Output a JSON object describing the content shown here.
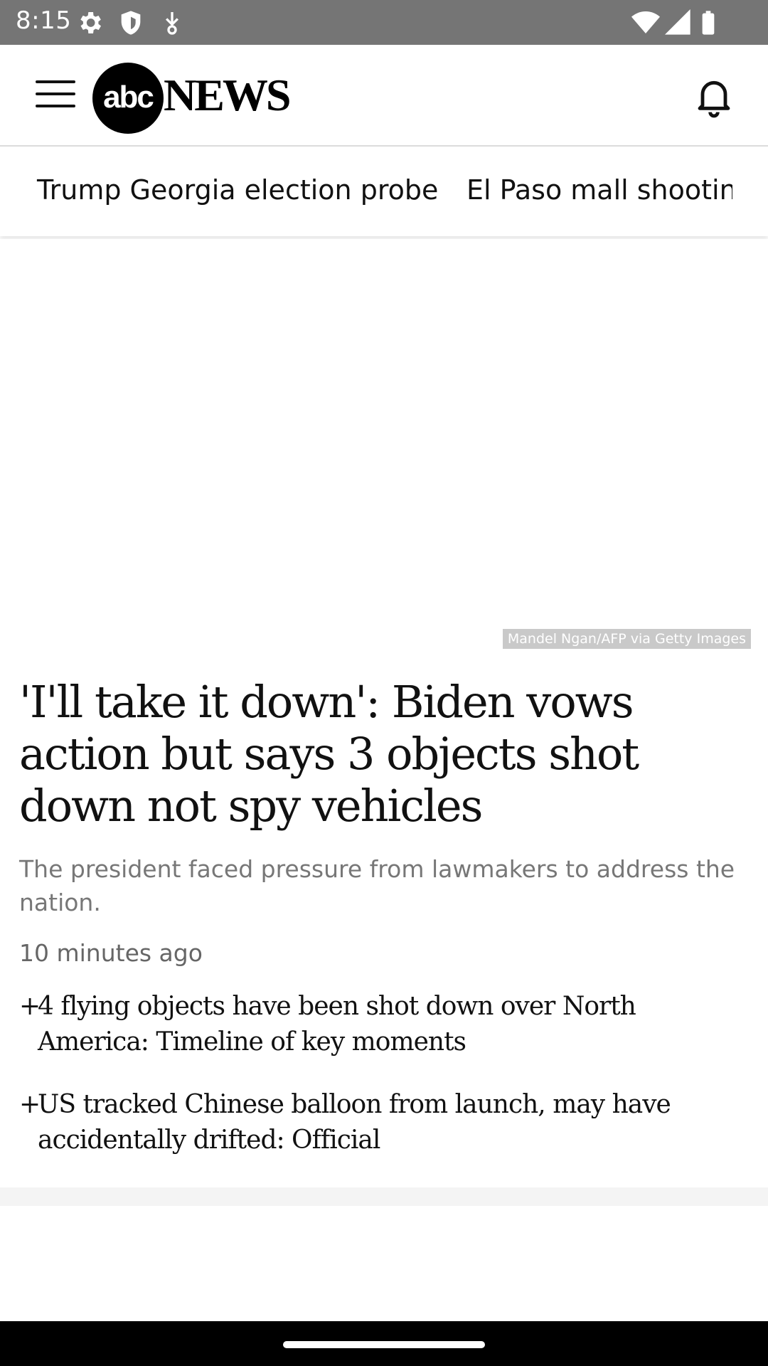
{
  "status_bar": {
    "time": "8:15",
    "icons_left": [
      "gear-icon",
      "shield-icon",
      "download-icon"
    ],
    "icons_right": [
      "wifi-icon",
      "signal-icon",
      "battery-icon"
    ]
  },
  "header": {
    "logo_mark": "abc",
    "logo_text": "NEWS"
  },
  "topics": [
    "Trump Georgia election probe",
    "El Paso mall shooting"
  ],
  "article": {
    "image_credit": "Mandel Ngan/AFP via Getty Images",
    "headline": "'I'll take it down': Biden vows action but says 3 objects shot down not spy vehicles",
    "summary": "The president faced pressure from lawmakers to address the nation.",
    "timestamp": "10 minutes ago"
  },
  "related": [
    {
      "prefix": "+",
      "text": "4 flying objects have been shot down over North America: Timeline of key moments"
    },
    {
      "prefix": "+",
      "text": "US tracked Chinese balloon from launch, may have accidentally drifted: Official"
    }
  ],
  "colors": {
    "status_bar": "#757575",
    "summary_text": "#777777",
    "nav_bar": "#000000"
  }
}
